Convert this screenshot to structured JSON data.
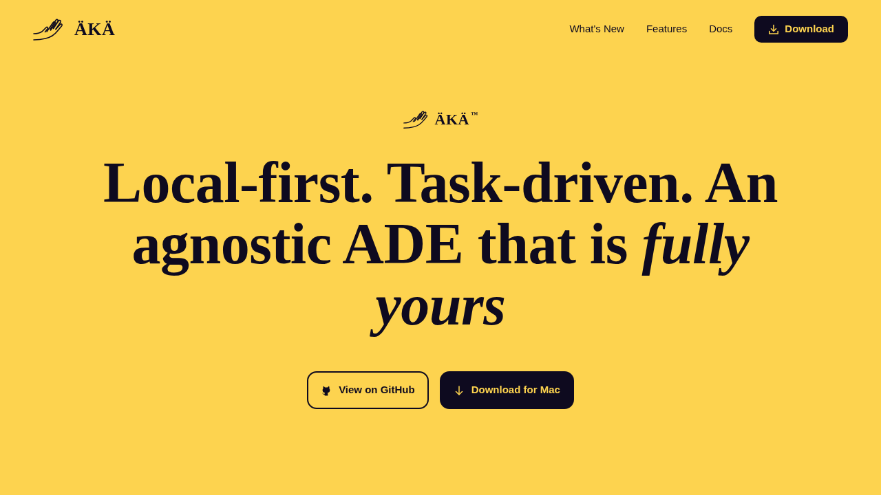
{
  "nav": {
    "logo": {
      "text": "ÄKÄ"
    },
    "links": [
      "What's New",
      "Features",
      "Docs"
    ],
    "cta": {
      "label": "Download"
    }
  },
  "hero": {
    "logo": {
      "text": "ÄKÄ$^{™}$"
    },
    "headline": "Local-first. Task-driven. An agnostic ADE that is *fully yours*",
    "buttons": [
      {
        "kind": "outline",
        "label": "View on GitHub"
      },
      {
        "kind": "solid",
        "label": "Download for Mac"
      }
    ]
  }
}
